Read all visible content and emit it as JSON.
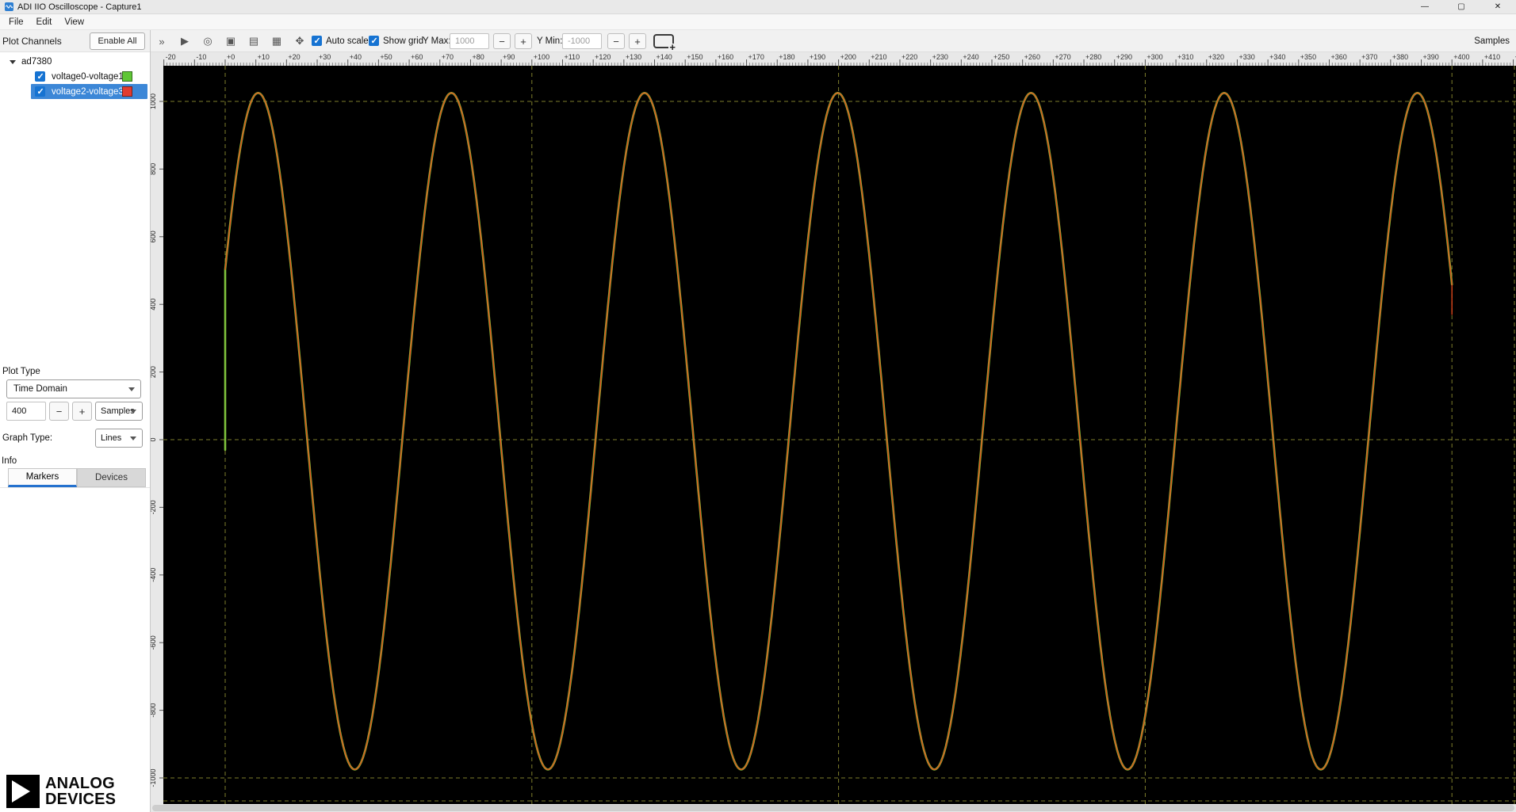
{
  "window": {
    "title": "ADI IIO Oscilloscope - Capture1",
    "minimize_glyph": "—",
    "maximize_glyph": "▢",
    "close_glyph": "✕"
  },
  "menu_bar": {
    "items": [
      "File",
      "Edit",
      "View"
    ]
  },
  "controls": {
    "minus_glyph": "−",
    "plus_glyph": "+"
  },
  "toolbar": {
    "icons": [
      {
        "name": "run-icon",
        "glyph": "»"
      },
      {
        "name": "play-icon",
        "glyph": "▶"
      },
      {
        "name": "record-icon",
        "glyph": "◎"
      },
      {
        "name": "snapshot-icon",
        "glyph": "▣"
      },
      {
        "name": "grid-view-icon",
        "glyph": "▤"
      },
      {
        "name": "table-view-icon",
        "glyph": "▦"
      },
      {
        "name": "pan-icon",
        "glyph": "✥"
      }
    ],
    "auto_scale": {
      "label": "Auto scale",
      "checked": true
    },
    "show_grid": {
      "label": "Show grid",
      "checked": true
    },
    "y_max": {
      "label": "Y Max:",
      "value": "1000",
      "disabled": true
    },
    "y_min": {
      "label": "Y Min:",
      "value": "-1000",
      "disabled": true
    },
    "axis_unit_label": "Samples"
  },
  "sidebar": {
    "header": {
      "title": "Plot Channels",
      "enable_all_label": "Enable All"
    },
    "device": {
      "name": "ad7380",
      "expanded": true
    },
    "selection_color": "#3c87d7",
    "channels": [
      {
        "label": "voltage0-voltage1",
        "checked": true,
        "swatch_color": "#5fc636",
        "selected": false
      },
      {
        "label": "voltage2-voltage3",
        "checked": true,
        "swatch_color": "#e03b30",
        "selected": true
      }
    ],
    "plot_type": {
      "label": "Plot Type",
      "value": "Time Domain"
    },
    "sample_count": {
      "value": "400",
      "unit_value": "Samples"
    },
    "graph_type": {
      "label": "Graph Type:",
      "value": "Lines"
    },
    "info_label": "Info",
    "tabs": [
      {
        "label": "Markers",
        "active": true
      },
      {
        "label": "Devices",
        "active": false
      }
    ]
  },
  "logo": {
    "line1": "ANALOG",
    "line2": "DEVICES"
  },
  "chart_data": {
    "type": "line",
    "title": "",
    "xlabel": "Samples",
    "plot_bg": "#000000",
    "x_range": [
      -20,
      421
    ],
    "x_major_tick_step": 10,
    "x_minor_tick_step": 1,
    "y_axis_ticks": [
      1000,
      800,
      600,
      400,
      200,
      0,
      -200,
      -400,
      -600,
      -800,
      -1000
    ],
    "y_view_range": [
      -1077,
      1105
    ],
    "grid": {
      "show": true,
      "color": "#7e7e2c",
      "vertical_line_samples": [
        0,
        100,
        200,
        300,
        400
      ],
      "horizontal_line_values": [
        1000,
        0,
        -1000
      ],
      "bottom_edge_line": true,
      "right_edge_line": true
    },
    "series": [
      {
        "name": "voltage0-voltage1",
        "color": "#7fc23c",
        "waveform": "sine",
        "amplitude": 1000,
        "offset": 25,
        "period_samples": 63,
        "peak_at_sample": 10.75,
        "sample_start": 0,
        "sample_end": 400,
        "stroke_width": 2.6,
        "start_tail_value": -30
      },
      {
        "name": "voltage2-voltage3",
        "color": "#e8481c",
        "waveform": "sine",
        "amplitude": 1000,
        "offset": 25,
        "period_samples": 63,
        "peak_at_sample": 10.75,
        "sample_start": 0,
        "sample_end": 400,
        "stroke_width": 1.3,
        "end_tail_value": 370
      }
    ]
  }
}
